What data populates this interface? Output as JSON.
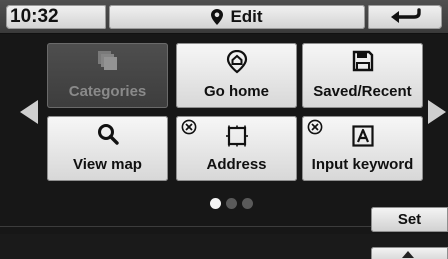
{
  "status_bar": {
    "time": "10:32",
    "title": "Edit",
    "title_icon": "location-pin-icon",
    "back_icon": "back-arrow-icon"
  },
  "tiles": [
    {
      "label": "Categories",
      "icon": "categories-icon",
      "enabled": false,
      "deletable": false
    },
    {
      "label": "Go home",
      "icon": "home-pin-icon",
      "enabled": true,
      "deletable": false
    },
    {
      "label": "Saved/Recent",
      "icon": "save-icon",
      "enabled": true,
      "deletable": false
    },
    {
      "label": "View map",
      "icon": "magnifier-icon",
      "enabled": true,
      "deletable": false
    },
    {
      "label": "Address",
      "icon": "address-frame-icon",
      "enabled": true,
      "deletable": true
    },
    {
      "label": "Input keyword",
      "icon": "keyword-a-icon",
      "enabled": true,
      "deletable": true
    }
  ],
  "pager": {
    "pages": 3,
    "current": 1
  },
  "set_button": {
    "label": "Set"
  },
  "colors": {
    "tile_face": "#e8e8e8",
    "tile_disabled": "#474747",
    "background": "#1a1a1a"
  }
}
